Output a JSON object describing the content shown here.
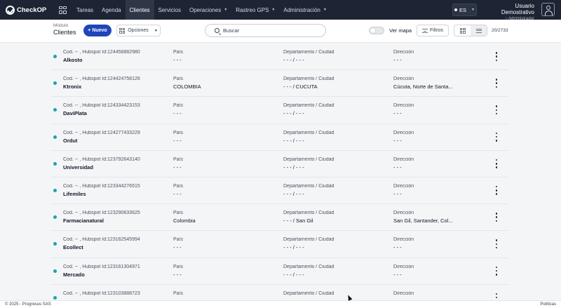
{
  "app": {
    "brand": "CheckOP"
  },
  "nav": {
    "items": [
      {
        "label": "Tareas",
        "caret": false,
        "active": false
      },
      {
        "label": "Agenda",
        "caret": false,
        "active": false
      },
      {
        "label": "Clientes",
        "caret": false,
        "active": true
      },
      {
        "label": "Servicios",
        "caret": false,
        "active": false
      },
      {
        "label": "Operaciones",
        "caret": true,
        "active": false
      },
      {
        "label": "Rastreo GPS",
        "caret": true,
        "active": false
      },
      {
        "label": "Administración",
        "caret": true,
        "active": false
      }
    ],
    "language": "ES",
    "user_name": "Usuario Demostrativo",
    "user_role": "Administrador"
  },
  "toolbar": {
    "module_label": "Módulo",
    "module_title": "Clientes",
    "new_label": "+ Nuevo",
    "options_label": "Opciones",
    "search_placeholder": "Buscar",
    "map_label": "Ver mapa",
    "filters_label": "Filtros",
    "count": "20/2733"
  },
  "columns": {
    "pais": "País",
    "depto": "Departamento / Ciudad",
    "direccion": "Dirección"
  },
  "rows": [
    {
      "code": "Cod. -- , Hubspot Id:124456882980",
      "name": "Alkosto",
      "pais": "- - -",
      "depto": "- - - / - - -",
      "direccion": "- - -"
    },
    {
      "code": "Cod. -- , Hubspot Id:124424758126",
      "name": "Ktronix",
      "pais": "COLOMBIA",
      "depto": "- - - / CUCUTA",
      "direccion": "Cúcuta, Norte de Santa..."
    },
    {
      "code": "Cod. -- , Hubspot Id:124334423153",
      "name": "DaviPlata",
      "pais": "- - -",
      "depto": "- - - / - - -",
      "direccion": "- - -"
    },
    {
      "code": "Cod. -- , Hubspot Id:124277433229",
      "name": "Ordut",
      "pais": "- - -",
      "depto": "- - - / - - -",
      "direccion": "- - -"
    },
    {
      "code": "Cod. -- , Hubspot Id:123792643140",
      "name": "Universidad",
      "pais": "- - -",
      "depto": "- - - / - - -",
      "direccion": "- - -"
    },
    {
      "code": "Cod. -- , Hubspot Id:123344276515",
      "name": "Lifemiles",
      "pais": "- - -",
      "depto": "- - - / - - -",
      "direccion": "- - -"
    },
    {
      "code": "Cod. -- , Hubspot Id:123290633625",
      "name": "Farmacianatural",
      "pais": "Colombia",
      "depto": "- - - / San Gil",
      "direccion": "San Gil, Santander, Col..."
    },
    {
      "code": "Cod. -- , Hubspot Id:123162545994",
      "name": "Ecollect",
      "pais": "- - -",
      "depto": "- - - / - - -",
      "direccion": "- - -"
    },
    {
      "code": "Cod. -- , Hubspot Id:123161304971",
      "name": "Mercado",
      "pais": "- - -",
      "depto": "- - - / - - -",
      "direccion": "- - -"
    },
    {
      "code": "Cod. -- , Hubspot Id:123103888723",
      "name": "",
      "pais": "",
      "depto": "",
      "direccion": ""
    }
  ],
  "footer": {
    "copyright": "© 2025 - Progresus SAS",
    "policies": "Políticas"
  },
  "colors": {
    "nav_bg": "#1d2433",
    "primary": "#1f46b9",
    "status_dot": "#1aa6a6"
  }
}
